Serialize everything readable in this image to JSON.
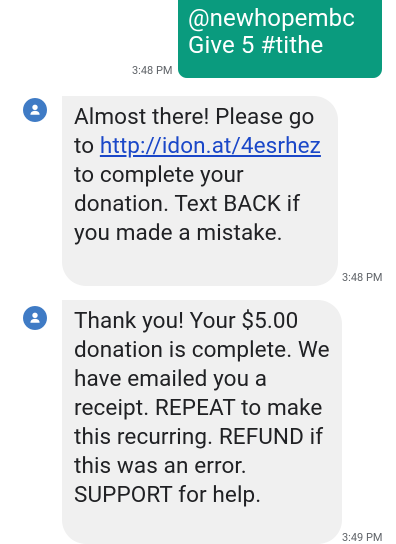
{
  "messages": [
    {
      "direction": "outgoing",
      "text": "@newhopembc\nGive 5 #tithe",
      "time": "3:48 PM"
    },
    {
      "direction": "incoming",
      "text_before_link": "Almost there! Please go to ",
      "link": "http://idon.at/4esrhez",
      "text_after_link": " to complete your donation. Text BACK if you made a mistake.",
      "time": "3:48 PM",
      "avatar_icon": "person-icon"
    },
    {
      "direction": "incoming",
      "text": "Thank you! Your $5.00 donation is complete. We have emailed you a receipt. REPEAT to make this recurring. REFUND if this was an error. SUPPORT for help.",
      "time": "3:49 PM",
      "avatar_icon": "person-icon"
    }
  ],
  "colors": {
    "outgoing_bubble": "#0a9b7e",
    "incoming_bubble": "#f0f0f0",
    "avatar": "#3f7bc5",
    "link": "#1a47c8"
  }
}
